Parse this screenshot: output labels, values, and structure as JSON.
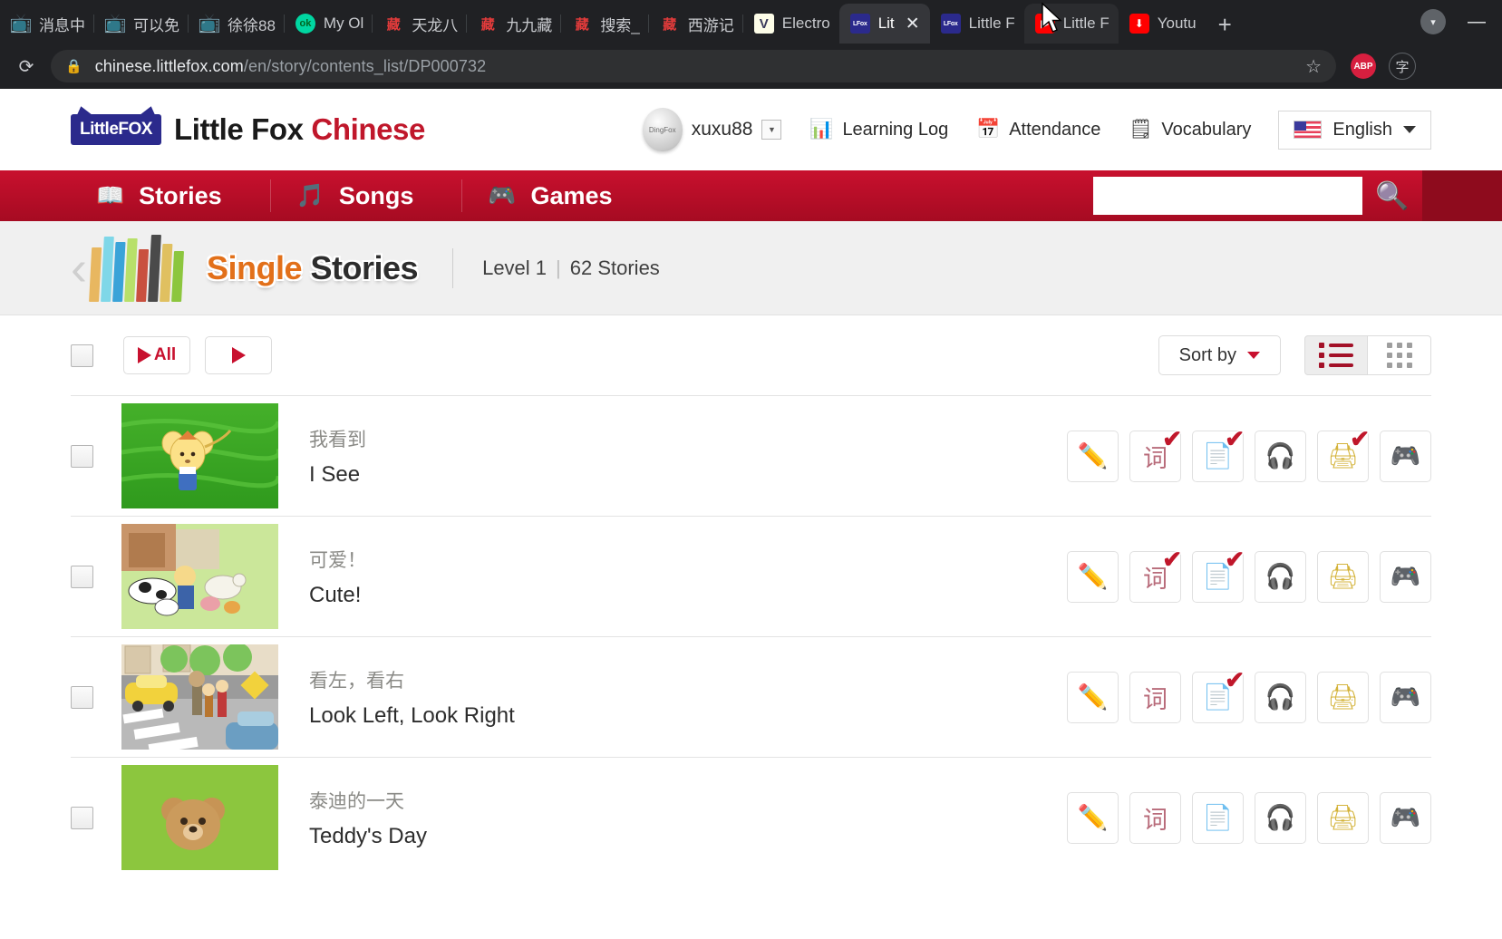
{
  "browser": {
    "tabs": [
      {
        "title": "消息中",
        "icon": "bilibili-icon",
        "state": "normal"
      },
      {
        "title": "可以免",
        "icon": "bilibili-icon",
        "state": "normal"
      },
      {
        "title": "徐徐88",
        "icon": "bilibili-icon",
        "state": "normal"
      },
      {
        "title": "My Ol",
        "icon": "ok-icon",
        "state": "normal"
      },
      {
        "title": "天龙八",
        "icon": "zang-icon",
        "state": "normal"
      },
      {
        "title": "九九藏",
        "icon": "zang-icon",
        "state": "normal"
      },
      {
        "title": "搜索_",
        "icon": "zang-icon",
        "state": "normal"
      },
      {
        "title": "西游记",
        "icon": "zang-icon",
        "state": "normal"
      },
      {
        "title": "Electro",
        "icon": "v-icon",
        "state": "normal"
      },
      {
        "title": "Lit",
        "icon": "littlefox-icon",
        "state": "active",
        "close": "✕"
      },
      {
        "title": "Little F",
        "icon": "littlefox-icon",
        "state": "normal"
      },
      {
        "title": "Little F",
        "icon": "youtube-icon",
        "state": "hovered"
      },
      {
        "title": "Youtu",
        "icon": "youtube-download-icon",
        "state": "normal"
      }
    ],
    "new_tab_label": "+",
    "profile_label": "",
    "minimize_label": "—",
    "url_domain": "chinese.littlefox.com",
    "url_path": "/en/story/contents_list/DP000732",
    "abp_label": "ABP",
    "avatar_label": "字"
  },
  "header": {
    "logo_badge": "LittleFOX",
    "logo_text_1": "Little Fox ",
    "logo_text_2": "Chinese",
    "user_name": "xuxu88",
    "user_avatar_label": "DingFox",
    "links": [
      {
        "label": "Learning Log",
        "icon": "bar-chart-icon"
      },
      {
        "label": "Attendance",
        "icon": "calendar-check-icon"
      },
      {
        "label": "Vocabulary",
        "icon": "notepad-icon"
      }
    ],
    "language": "English",
    "language_icon": "us-flag-icon"
  },
  "nav": {
    "items": [
      {
        "label": "Stories",
        "icon": "book-icon"
      },
      {
        "label": "Songs",
        "icon": "music-note-icon"
      },
      {
        "label": "Games",
        "icon": "gamepad-icon"
      }
    ],
    "search_value": "",
    "search_placeholder": "",
    "search_icon": "search-icon"
  },
  "banner": {
    "back_icon": "back-chevron-icon",
    "books_icon": "books-icon",
    "title_1": "Single",
    "title_2": "Stories",
    "level": "Level 1",
    "separator": "|",
    "count": "62 Stories"
  },
  "toolbar": {
    "select_all_checkbox": "",
    "play_all_label": "All",
    "play_label": "",
    "sort_by_label": "Sort by",
    "list_view_icon": "list-view-icon",
    "grid_view_icon": "grid-view-icon"
  },
  "stories": [
    {
      "title_cn": "我看到",
      "title_en": "I See",
      "thumb_bg": "#3faa26",
      "thumb_kind": "mouse-on-grass",
      "actions": [
        {
          "icon": "pencil-icon",
          "done": false
        },
        {
          "icon": "wordcard-icon",
          "done": true
        },
        {
          "icon": "quiz-icon",
          "done": true
        },
        {
          "icon": "headphone-icon",
          "done": false
        },
        {
          "icon": "print-icon",
          "done": true
        },
        {
          "icon": "game-icon",
          "done": false
        }
      ]
    },
    {
      "title_cn": "可爱！",
      "title_en": "Cute!",
      "thumb_bg": "#b7d98a",
      "thumb_kind": "farm-animals",
      "actions": [
        {
          "icon": "pencil-icon",
          "done": false
        },
        {
          "icon": "wordcard-icon",
          "done": true
        },
        {
          "icon": "quiz-icon",
          "done": true
        },
        {
          "icon": "headphone-icon",
          "done": false
        },
        {
          "icon": "print-icon",
          "done": false
        },
        {
          "icon": "game-icon",
          "done": false
        }
      ]
    },
    {
      "title_cn": "看左，看右",
      "title_en": "Look Left, Look Right",
      "thumb_bg": "#9fc7d6",
      "thumb_kind": "crosswalk-street",
      "actions": [
        {
          "icon": "pencil-icon",
          "done": false
        },
        {
          "icon": "wordcard-icon",
          "done": false
        },
        {
          "icon": "quiz-icon",
          "done": true
        },
        {
          "icon": "headphone-icon",
          "done": false
        },
        {
          "icon": "print-icon",
          "done": false
        },
        {
          "icon": "game-icon",
          "done": false
        }
      ]
    },
    {
      "title_cn": "泰迪的一天",
      "title_en": "Teddy's Day",
      "thumb_bg": "#8cc63e",
      "thumb_kind": "teddy-bear",
      "actions": [
        {
          "icon": "pencil-icon",
          "done": false
        },
        {
          "icon": "wordcard-icon",
          "done": false
        },
        {
          "icon": "quiz-icon",
          "done": false
        },
        {
          "icon": "headphone-icon",
          "done": false
        },
        {
          "icon": "print-icon",
          "done": false
        },
        {
          "icon": "game-icon",
          "done": false
        }
      ]
    }
  ]
}
